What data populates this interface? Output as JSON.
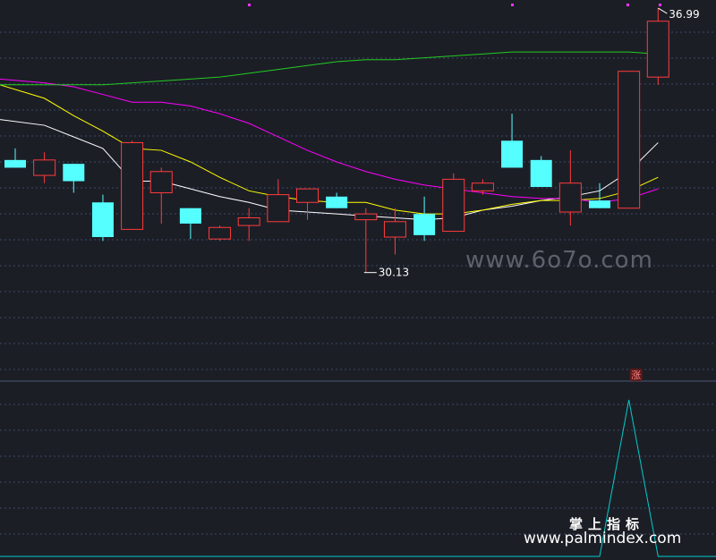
{
  "chart_data": {
    "type": "candlestick",
    "price_ylim": [
      27.5,
      37.2
    ],
    "annotations": {
      "high_label": "36.99",
      "low_label": "30.13",
      "zhang_badge": "涨"
    },
    "candles": [
      {
        "o": 33.05,
        "h": 33.35,
        "c": 32.85,
        "l": 32.85
      },
      {
        "o": 32.65,
        "h": 33.25,
        "c": 33.05,
        "l": 32.45
      },
      {
        "o": 32.95,
        "h": 32.95,
        "c": 32.5,
        "l": 32.2
      },
      {
        "o": 31.95,
        "h": 32.15,
        "c": 31.05,
        "l": 30.95
      },
      {
        "o": 31.25,
        "h": 33.55,
        "c": 33.5,
        "l": 31.25
      },
      {
        "o": 32.2,
        "h": 32.85,
        "c": 32.75,
        "l": 31.4
      },
      {
        "o": 31.8,
        "h": 31.8,
        "c": 31.4,
        "l": 31.0
      },
      {
        "o": 31.0,
        "h": 31.35,
        "c": 31.3,
        "l": 30.95
      },
      {
        "o": 31.35,
        "h": 31.8,
        "c": 31.55,
        "l": 30.95
      },
      {
        "o": 31.45,
        "h": 32.55,
        "c": 32.15,
        "l": 31.45
      },
      {
        "o": 31.95,
        "h": 32.25,
        "c": 32.3,
        "l": 31.5
      },
      {
        "o": 32.1,
        "h": 32.2,
        "c": 31.8,
        "l": 31.8
      },
      {
        "o": 31.5,
        "h": 31.8,
        "c": 31.65,
        "l": 30.13
      },
      {
        "o": 31.05,
        "h": 31.8,
        "c": 31.45,
        "l": 30.6
      },
      {
        "o": 31.65,
        "h": 32.1,
        "c": 31.1,
        "l": 30.95
      },
      {
        "o": 31.2,
        "h": 32.7,
        "c": 32.55,
        "l": 31.2
      },
      {
        "o": 32.25,
        "h": 32.55,
        "c": 32.45,
        "l": 32.15
      },
      {
        "o": 33.55,
        "h": 34.25,
        "c": 32.85,
        "l": 32.85
      },
      {
        "o": 33.05,
        "h": 33.15,
        "c": 32.35,
        "l": 32.35
      },
      {
        "o": 31.7,
        "h": 33.3,
        "c": 32.45,
        "l": 31.35
      },
      {
        "o": 32.0,
        "h": 32.45,
        "c": 31.8,
        "l": 31.8
      },
      {
        "o": 31.8,
        "h": 35.35,
        "c": 35.35,
        "l": 31.8
      },
      {
        "o": 35.2,
        "h": 36.99,
        "c": 36.65,
        "l": 35.0
      }
    ],
    "ma_lines": [
      {
        "color": "#ffffff",
        "values": [
          34.1,
          33.95,
          33.65,
          33.35,
          32.5,
          32.5,
          32.3,
          32.1,
          31.95,
          31.75,
          31.7,
          31.65,
          31.6,
          31.55,
          31.5,
          31.55,
          31.75,
          31.85,
          32.0,
          32.1,
          32.25,
          32.75,
          33.5
        ]
      },
      {
        "color": "#ffff00",
        "values": [
          35.0,
          34.65,
          34.2,
          33.8,
          33.35,
          33.3,
          33.0,
          32.6,
          32.25,
          32.1,
          32.0,
          31.95,
          31.95,
          31.75,
          31.65,
          31.65,
          31.75,
          31.9,
          32.0,
          32.0,
          32.05,
          32.25,
          32.6
        ]
      },
      {
        "color": "#ff00ff",
        "values": [
          35.15,
          35.05,
          34.95,
          34.75,
          34.55,
          34.55,
          34.45,
          34.25,
          34.0,
          33.65,
          33.3,
          33.0,
          32.75,
          32.55,
          32.4,
          32.3,
          32.2,
          32.1,
          32.05,
          32.05,
          31.95,
          32.05,
          32.3
        ]
      },
      {
        "color": "#22cc22",
        "values": [
          35.0,
          35.0,
          35.0,
          35.0,
          35.05,
          35.1,
          35.15,
          35.2,
          35.3,
          35.4,
          35.5,
          35.6,
          35.65,
          35.65,
          35.7,
          35.75,
          35.8,
          35.85,
          35.85,
          35.85,
          35.85,
          35.85,
          35.8
        ]
      }
    ],
    "indicator": {
      "color": "#00cccc",
      "ylim": [
        0,
        1
      ],
      "values": [
        0,
        0,
        0,
        0,
        0,
        0,
        0,
        0,
        0,
        0,
        0,
        0,
        0,
        0,
        0,
        0,
        0,
        0,
        0,
        0,
        0,
        1,
        0
      ]
    },
    "colors": {
      "up": "#ff3b3b",
      "down": "#55ffff",
      "grid": "#3a4a66",
      "background": "#1c1e26",
      "label": "#ffffff",
      "watermark": "#6a6d78"
    }
  },
  "watermarks": {
    "mid": "www.6o7o.com",
    "cn": "掌上指标",
    "site": "www.palmindex.com"
  }
}
